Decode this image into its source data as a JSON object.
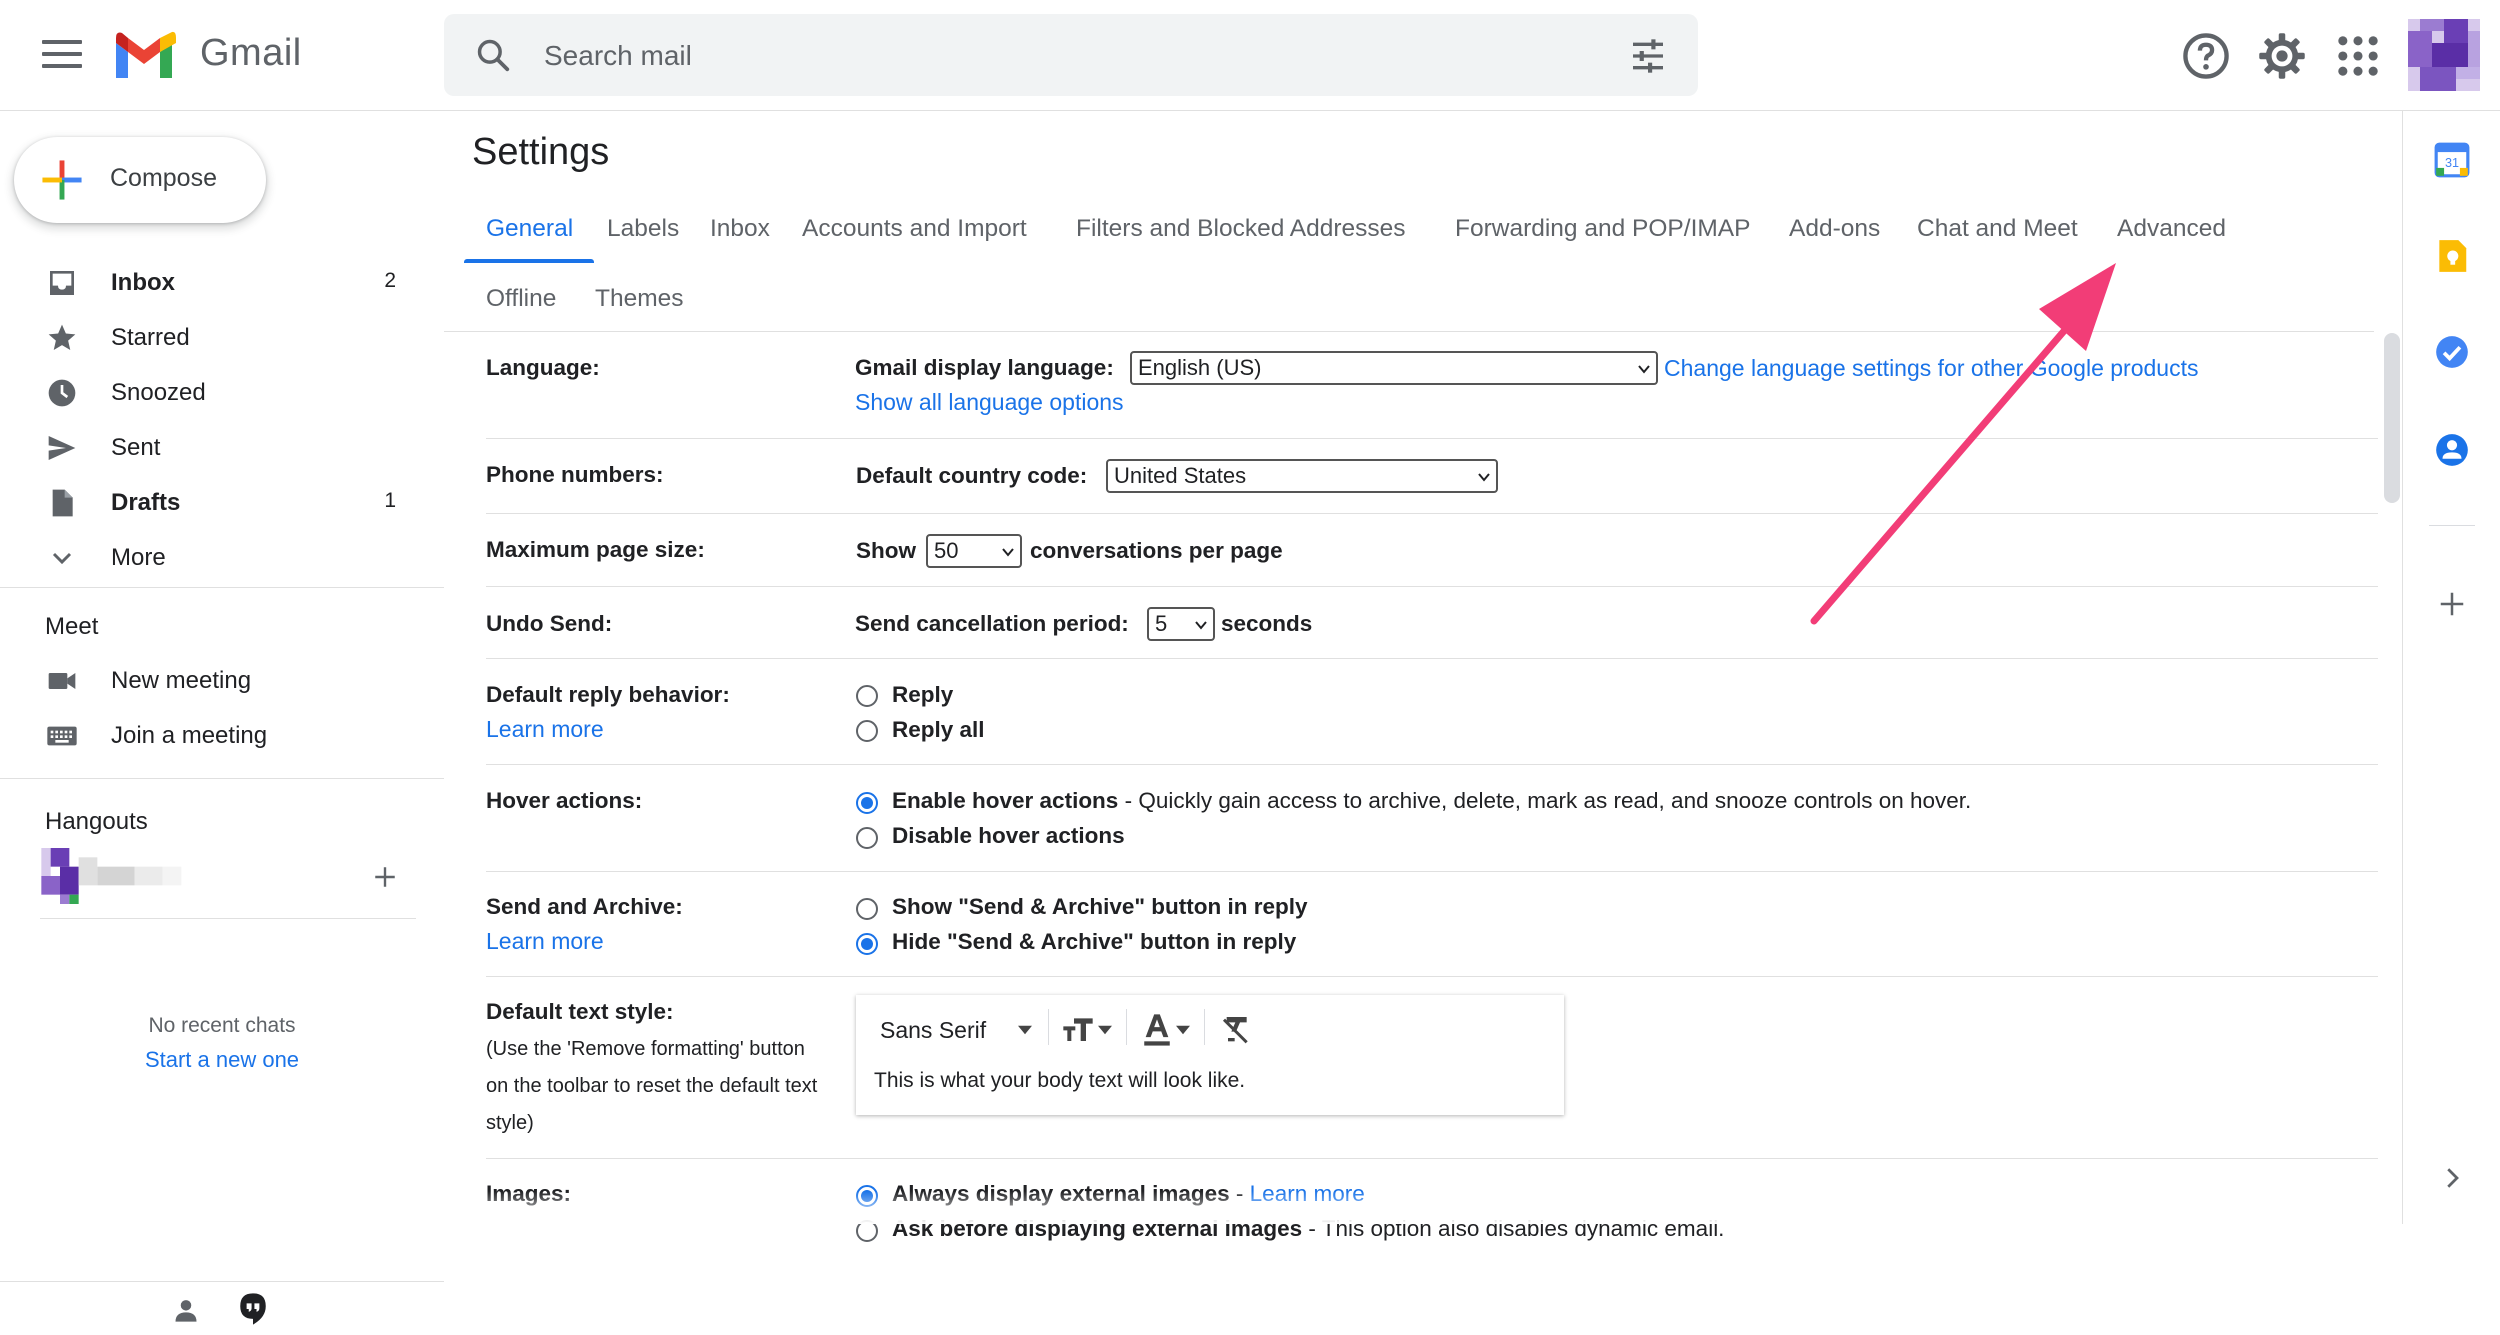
{
  "header": {
    "brand": "Gmail",
    "search_placeholder": "Search mail"
  },
  "sidebar": {
    "compose_label": "Compose",
    "items": [
      {
        "label": "Inbox",
        "count": "2"
      },
      {
        "label": "Starred",
        "count": ""
      },
      {
        "label": "Snoozed",
        "count": ""
      },
      {
        "label": "Sent",
        "count": ""
      },
      {
        "label": "Drafts",
        "count": "1"
      },
      {
        "label": "More",
        "count": ""
      }
    ],
    "meet": {
      "title": "Meet",
      "new_meeting": "New meeting",
      "join_meeting": "Join a meeting"
    },
    "hangouts": {
      "title": "Hangouts",
      "no_recent": "No recent chats",
      "start_new": "Start a new one"
    }
  },
  "rail": {
    "calendar_date": "31"
  },
  "settings": {
    "title": "Settings",
    "tabs": [
      "General",
      "Labels",
      "Inbox",
      "Accounts and Import",
      "Filters and Blocked Addresses",
      "Forwarding and POP/IMAP",
      "Add-ons",
      "Chat and Meet",
      "Advanced",
      "Offline",
      "Themes"
    ],
    "language": {
      "label": "Language:",
      "display_label": "Gmail display language:",
      "value": "English (US)",
      "change_link": "Change language settings for other Google products",
      "show_all": "Show all language options"
    },
    "phone": {
      "label": "Phone numbers:",
      "country_label": "Default country code:",
      "value": "United States"
    },
    "page_size": {
      "label": "Maximum page size:",
      "show": "Show",
      "value": "50",
      "suffix": "conversations per page"
    },
    "undo": {
      "label": "Undo Send:",
      "period_label": "Send cancellation period:",
      "value": "5",
      "suffix": "seconds"
    },
    "reply": {
      "label": "Default reply behavior:",
      "learn_more": "Learn more",
      "opt1": "Reply",
      "opt2": "Reply all"
    },
    "hover": {
      "label": "Hover actions:",
      "opt1": "Enable hover actions",
      "opt1_desc": " - Quickly gain access to archive, delete, mark as read, and snooze controls on hover.",
      "opt2": "Disable hover actions"
    },
    "send_archive": {
      "label": "Send and Archive:",
      "learn_more": "Learn more",
      "opt1": "Show \"Send & Archive\" button in reply",
      "opt2": "Hide \"Send & Archive\" button in reply"
    },
    "text_style": {
      "label": "Default text style:",
      "help1": "(Use the 'Remove formatting' button",
      "help2": "on the toolbar to reset the default text",
      "help3": "style)",
      "font": "Sans Serif",
      "preview": "This is what your body text will look like."
    },
    "images": {
      "label": "Images:",
      "opt1": "Always display external images",
      "opt1_sep": " - ",
      "learn_more": "Learn more",
      "opt2": "Ask before displaying external images",
      "opt2_desc": " - This option also disables dynamic email."
    }
  },
  "colors": {
    "accent": "#1a73e8",
    "annotation_arrow": "#f23d77"
  }
}
